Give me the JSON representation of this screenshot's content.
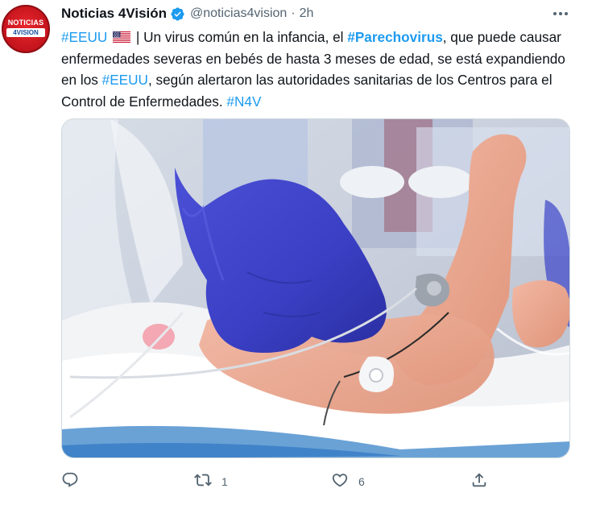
{
  "tweet": {
    "display_name": "Noticias 4Visión",
    "handle": "@noticias4vision",
    "separator": "·",
    "time": "2h",
    "avatar": {
      "line1": "NOTICIAS",
      "line2": "4VISION"
    },
    "text": {
      "tag1": "#EEUU",
      "seg1": " | Un virus común en la infancia, el ",
      "tag2": "#Parechovirus",
      "seg2": ", que puede causar enfermedades severas en bebés de hasta 3 meses de edad, se está expandiendo en los ",
      "tag3": "#EEUU",
      "seg3": ", según alertaron las autoridades sanitarias de los Centros para el Control de Enfermedades. ",
      "tag4": "#N4V"
    },
    "media": {
      "alt_icon": "newborn-stethoscope-photo"
    }
  },
  "actions": {
    "reply": {
      "icon": "reply-icon",
      "count": ""
    },
    "retweet": {
      "icon": "retweet-icon",
      "count": "1"
    },
    "like": {
      "icon": "heart-icon",
      "count": "6"
    },
    "share": {
      "icon": "share-icon",
      "count": ""
    }
  },
  "colors": {
    "link": "#1d9bf0",
    "secondary": "#536471",
    "verified": "#1d9bf0",
    "brand_red": "#d01c23"
  }
}
